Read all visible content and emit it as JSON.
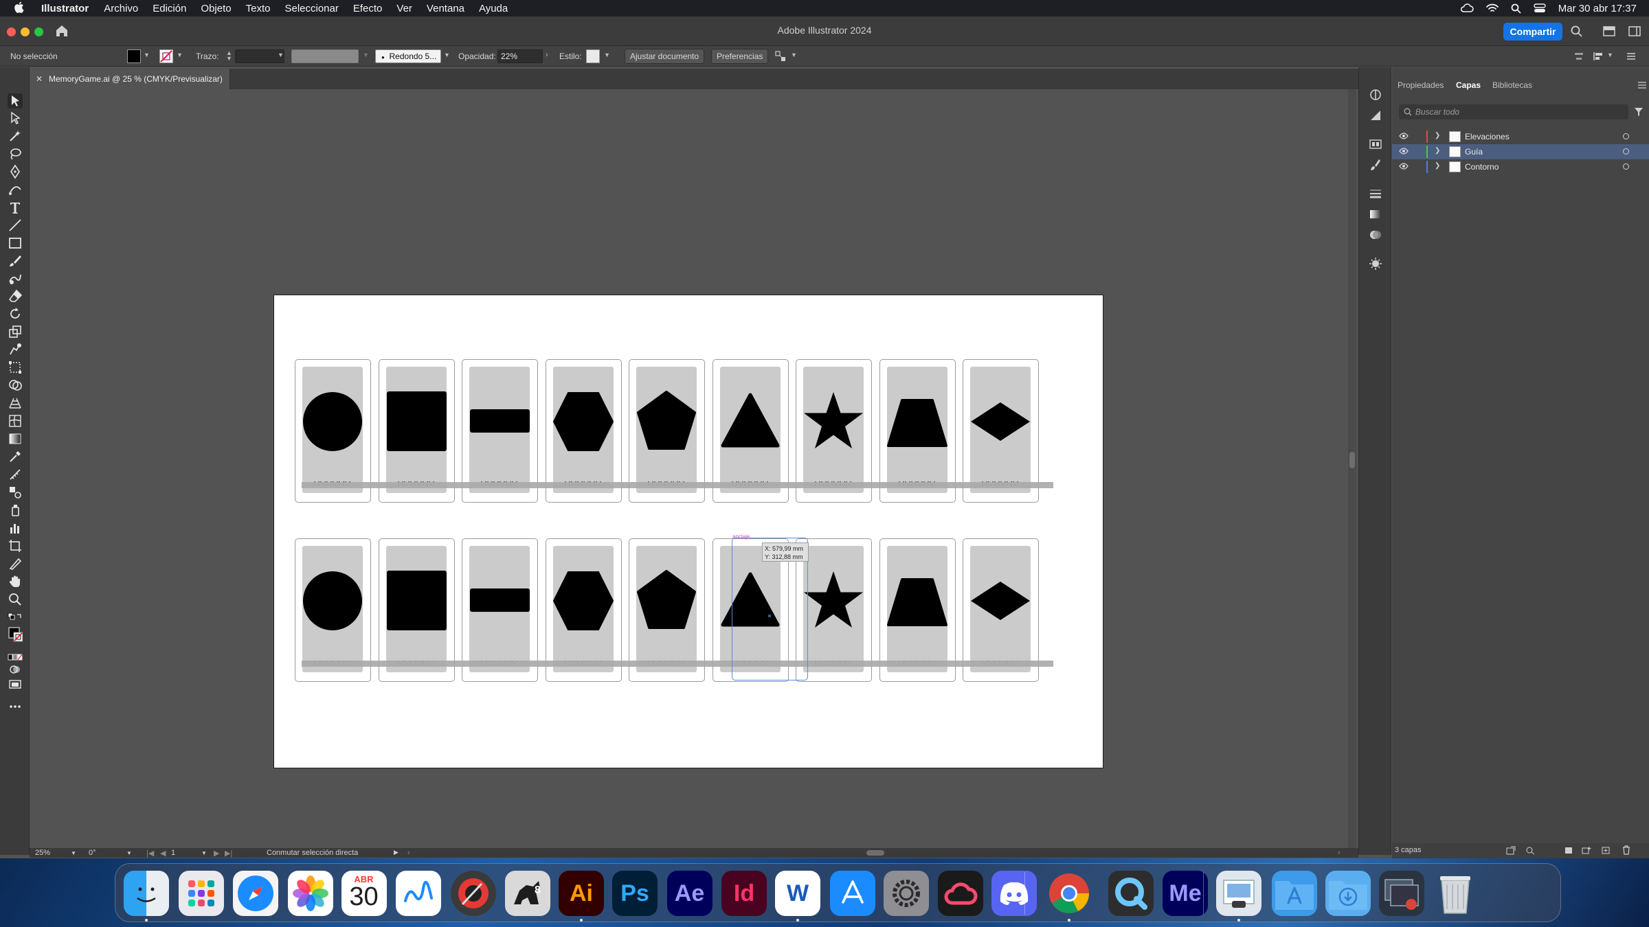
{
  "menubar": {
    "app_name": "Illustrator",
    "items": [
      "Archivo",
      "Edición",
      "Objeto",
      "Texto",
      "Seleccionar",
      "Efecto",
      "Ver",
      "Ventana",
      "Ayuda"
    ],
    "clock": "Mar 30 abr 17:37"
  },
  "window": {
    "title": "Adobe Illustrator 2024",
    "share_label": "Compartir"
  },
  "control_bar": {
    "selection": "No selección",
    "stroke_label": "Trazo:",
    "brush": "Redondo 5...",
    "opacity_label": "Opacidad:",
    "opacity_value": "22%",
    "style_label": "Estilo:",
    "fit_document": "Ajustar documento",
    "preferences": "Preferencias"
  },
  "document_tab": {
    "name": "MemoryGame.ai @ 25 % (CMYK/Previsualizar)"
  },
  "canvas": {
    "shapes": [
      "circle",
      "square",
      "rectangle",
      "hexagon",
      "pentagon",
      "triangle",
      "star",
      "trapezoid",
      "diamond"
    ],
    "rows": 2,
    "coord_tooltip_x": "X: 579,99 mm",
    "coord_tooltip_y": "Y: 312,88 mm",
    "origin_label": "anclaje"
  },
  "layers_panel": {
    "tabs": [
      "Propiedades",
      "Capas",
      "Bibliotecas"
    ],
    "active_tab": "Capas",
    "search_placeholder": "Buscar todo",
    "layers": [
      {
        "name": "Elevaciones",
        "color": "#e04848",
        "selected": false
      },
      {
        "name": "Guía",
        "color": "#49c651",
        "selected": true
      },
      {
        "name": "Contorno",
        "color": "#4a7bef",
        "selected": false
      }
    ],
    "count_label": "3 capas"
  },
  "status_bar": {
    "zoom": "25%",
    "rotation": "0°",
    "artboard_number": "1",
    "mode": "Conmutar selección directa"
  },
  "dock": {
    "calendar_month": "ABR",
    "calendar_day": "30",
    "apps": [
      {
        "name": "Finder",
        "label": ""
      },
      {
        "name": "Launchpad",
        "label": ""
      },
      {
        "name": "Safari",
        "label": ""
      },
      {
        "name": "Fotos",
        "label": ""
      },
      {
        "name": "Calendario",
        "label": ""
      },
      {
        "name": "Freeform",
        "label": ""
      },
      {
        "name": "Digital Color Meter",
        "label": ""
      },
      {
        "name": "Rhino 8",
        "label": ""
      },
      {
        "name": "Illustrator",
        "label": "Ai"
      },
      {
        "name": "Photoshop",
        "label": "Ps"
      },
      {
        "name": "After Effects",
        "label": "Ae"
      },
      {
        "name": "InDesign",
        "label": "Id"
      },
      {
        "name": "Word",
        "label": "W"
      },
      {
        "name": "App Store",
        "label": ""
      },
      {
        "name": "Ajustes del Sistema",
        "label": ""
      },
      {
        "name": "Creative Cloud",
        "label": ""
      },
      {
        "name": "Discord",
        "label": ""
      },
      {
        "name": "Chrome",
        "label": ""
      },
      {
        "name": "QuickTime",
        "label": ""
      },
      {
        "name": "Media Encoder",
        "label": "Me"
      },
      {
        "name": "Preview",
        "label": ""
      },
      {
        "name": "Aplicaciones",
        "label": ""
      },
      {
        "name": "Descargas",
        "label": ""
      },
      {
        "name": "Capturas",
        "label": ""
      },
      {
        "name": "Papelera",
        "label": ""
      }
    ]
  },
  "colors": {
    "accent": "#1473e6",
    "illustrator": "#ff9a00",
    "photoshop": "#31a8ff",
    "after_effects": "#9999ff",
    "indesign": "#ff3366",
    "media_encoder": "#9999ff"
  }
}
